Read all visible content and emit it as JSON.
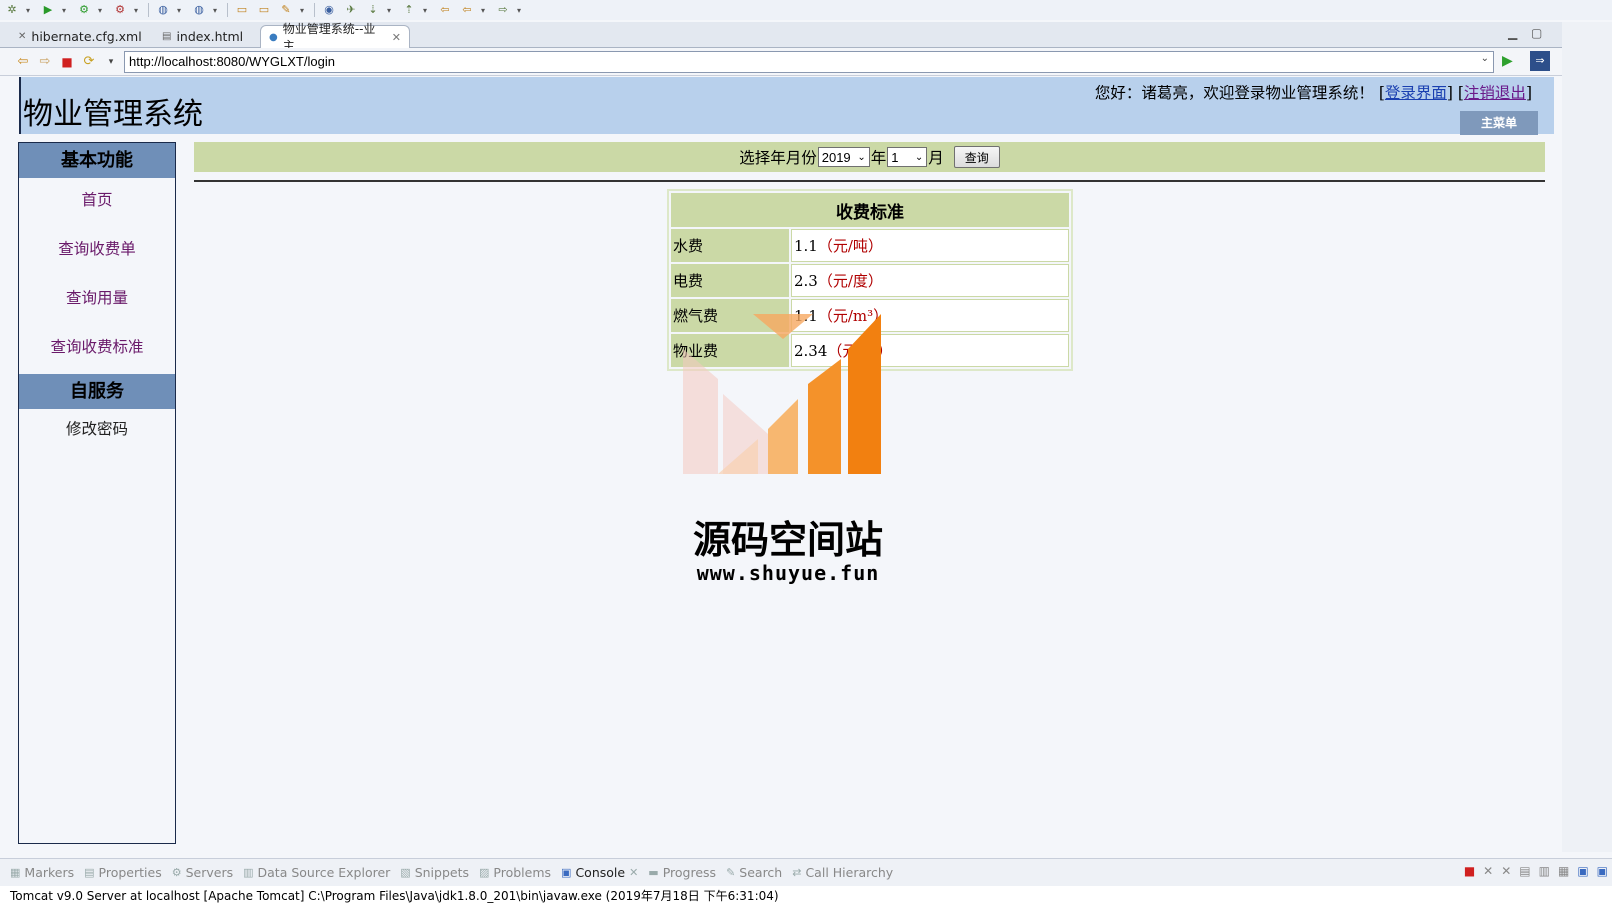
{
  "tabs": [
    {
      "label": "hibernate.cfg.xml",
      "icon": "xml-file-icon"
    },
    {
      "label": "index.html",
      "icon": "html-file-icon"
    },
    {
      "label": "物业管理系统--业主",
      "icon": "globe-icon",
      "active": true
    }
  ],
  "browser": {
    "url": "http://localhost:8080/WYGLXT/login"
  },
  "header": {
    "title": "物业管理系统",
    "welcome_prefix": "您好：诸葛亮，欢迎登录物业管理系统！ [",
    "login_link": "登录界面",
    "sep": "] [",
    "logout_link": "注销退出",
    "welcome_suffix": "]",
    "main_menu": "主菜单"
  },
  "sidebar": {
    "basic_heading": "基本功能",
    "basic_items": [
      "首页",
      "查询收费单",
      "查询用量",
      "查询收费标准"
    ],
    "self_heading": "自服务",
    "self_items": [
      "修改密码"
    ]
  },
  "query": {
    "label": "选择年月份",
    "year_value": "2019",
    "year_suffix": "年",
    "month_value": "1",
    "month_suffix": "月",
    "button": "查询"
  },
  "fee_table": {
    "title": "收费标准",
    "rows": [
      {
        "label": "水费",
        "value": "1.1",
        "unit": "（元/吨）"
      },
      {
        "label": "电费",
        "value": "2.3",
        "unit": "（元/度）"
      },
      {
        "label": "燃气费",
        "value": "1.1",
        "unit": "（元/m³）"
      },
      {
        "label": "物业费",
        "value": "2.34",
        "unit": "（元/月）"
      }
    ]
  },
  "watermark": {
    "title": "源码空间站",
    "url": "www.shuyue.fun"
  },
  "views": [
    {
      "label": "Markers"
    },
    {
      "label": "Properties"
    },
    {
      "label": "Servers"
    },
    {
      "label": "Data Source Explorer"
    },
    {
      "label": "Snippets"
    },
    {
      "label": "Problems"
    },
    {
      "label": "Console",
      "active": true
    },
    {
      "label": "Progress"
    },
    {
      "label": "Search"
    },
    {
      "label": "Call Hierarchy"
    }
  ],
  "console": {
    "line": "Tomcat v9.0 Server at localhost [Apache Tomcat] C:\\Program Files\\Java\\jdk1.8.0_201\\bin\\javaw.exe (2019年7月18日 下午6:31:04)"
  },
  "colors": {
    "header_bg": "#b8d0ec",
    "sidebar_heading": "#6f8fb8",
    "green_bar": "#cbd9a6",
    "unit_red": "#b00000",
    "link_purple": "#6a1a6a"
  }
}
